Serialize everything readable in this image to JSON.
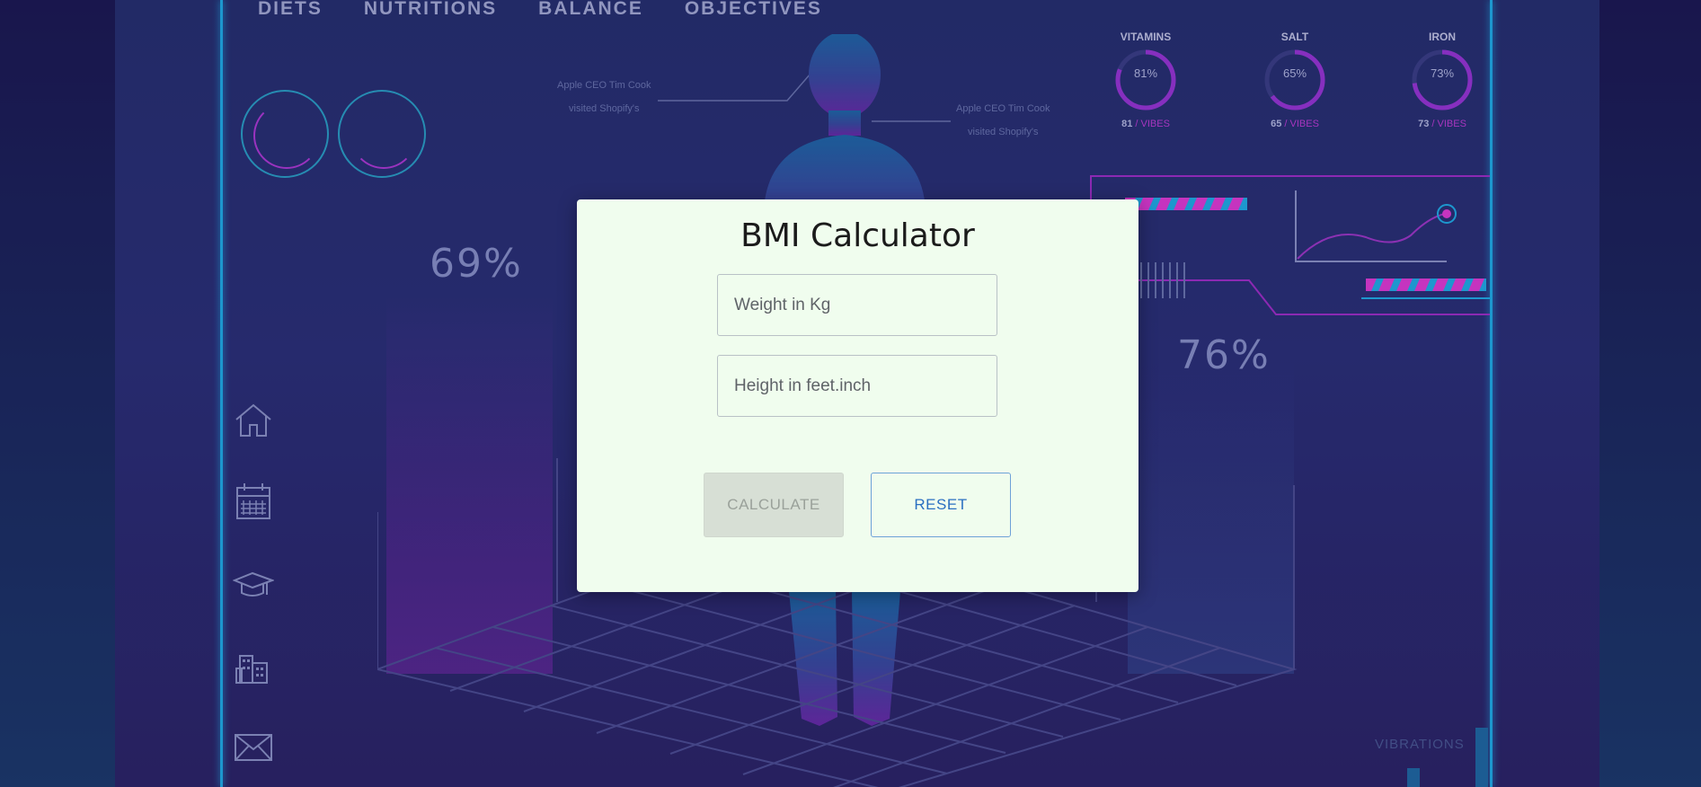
{
  "background": {
    "nav": [
      "DIETS",
      "NUTRITIONS",
      "BALANCE",
      "OBJECTIVES"
    ],
    "gauges": [
      {
        "label": "VITAMINS",
        "percent": "81%",
        "value": "81",
        "unit": "VIBES",
        "fraction": 0.81
      },
      {
        "label": "SALT",
        "percent": "65%",
        "value": "65",
        "unit": "VIBES",
        "fraction": 0.65
      },
      {
        "label": "IRON",
        "percent": "73%",
        "value": "73",
        "unit": "VIBES",
        "fraction": 0.73
      }
    ],
    "annotation_left": [
      "Apple CEO Tim Cook",
      "visited Shopify's"
    ],
    "annotation_right": [
      "Apple CEO Tim Cook",
      "visited Shopify's"
    ],
    "stat_left": "69%",
    "stat_right": "76%",
    "vibrations_label": "VIBRATIONS",
    "side_icons": [
      "home-icon",
      "calendar-icon",
      "graduation-cap-icon",
      "buildings-icon",
      "mail-icon"
    ],
    "colors": {
      "accent_cyan": "#1fb0e8",
      "accent_magenta": "#c23dd6",
      "panel": "#2a2f76"
    }
  },
  "modal": {
    "title": "BMI Calculator",
    "weight_placeholder": "Weight in Kg",
    "height_placeholder": "Height in feet.inch",
    "calculate_label": "CALCULATE",
    "reset_label": "RESET",
    "colors": {
      "background": "#f0fdee",
      "reset_text": "#2a6fc1",
      "calculate_disabled": "#d7dfd5"
    }
  }
}
